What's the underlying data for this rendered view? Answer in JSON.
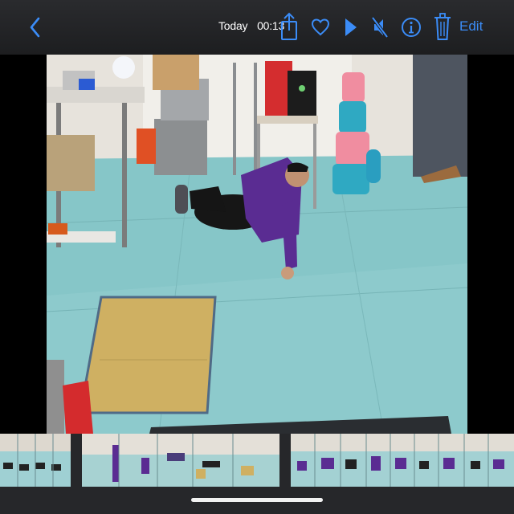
{
  "nav": {
    "back_icon": "chevron-left-icon",
    "title_date": "Today",
    "title_time": "00:13",
    "edit_label": "Edit",
    "accent_color": "#3b8cf7"
  },
  "toolbar": {
    "icons": [
      "share-icon",
      "heart-icon",
      "play-icon",
      "speaker-mute-icon",
      "info-icon",
      "trash-icon"
    ]
  },
  "photo": {
    "scene": "robotics lab floor"
  },
  "scrubber": {
    "icon": "film-strip"
  }
}
